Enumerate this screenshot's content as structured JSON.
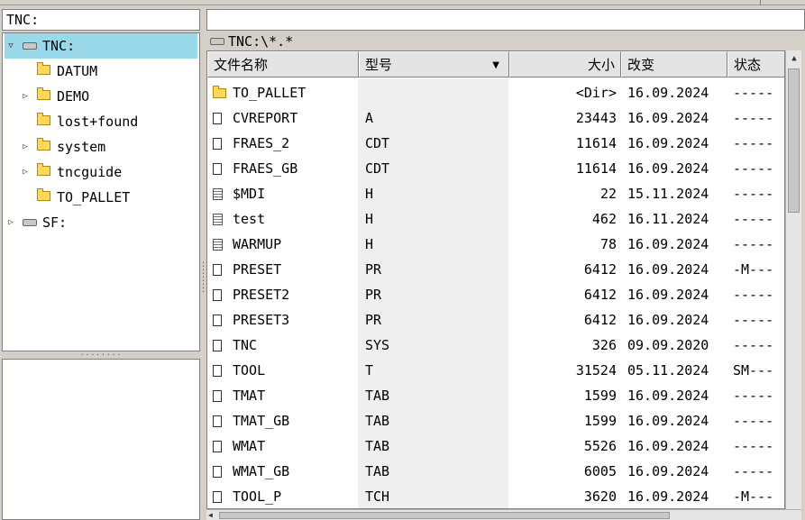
{
  "left_path": "TNC:",
  "right_path": "TNC:\\*.*",
  "tree": [
    {
      "label": "TNC:",
      "kind": "drive",
      "level": 0,
      "expander": "expanded",
      "selected": true
    },
    {
      "label": "DATUM",
      "kind": "folder",
      "level": 1,
      "expander": "none"
    },
    {
      "label": "DEMO",
      "kind": "folder",
      "level": 1,
      "expander": "collapsed"
    },
    {
      "label": "lost+found",
      "kind": "folder",
      "level": 1,
      "expander": "none"
    },
    {
      "label": "system",
      "kind": "folder",
      "level": 1,
      "expander": "collapsed"
    },
    {
      "label": "tncguide",
      "kind": "folder",
      "level": 1,
      "expander": "collapsed"
    },
    {
      "label": "TO_PALLET",
      "kind": "folder",
      "level": 1,
      "expander": "none"
    },
    {
      "label": "SF:",
      "kind": "drive",
      "level": 0,
      "expander": "collapsed"
    }
  ],
  "columns": {
    "name": "文件名称",
    "type": "型号",
    "size": "大小",
    "changed": "改变",
    "status": "状态"
  },
  "files": [
    {
      "icon": "folder",
      "name": "TO_PALLET",
      "type": "",
      "size": "<Dir>",
      "date": "16.09.2024",
      "status": "-----"
    },
    {
      "icon": "file",
      "name": "CVREPORT",
      "type": "A",
      "size": "23443",
      "date": "16.09.2024",
      "status": "-----"
    },
    {
      "icon": "file",
      "name": "FRAES_2",
      "type": "CDT",
      "size": "11614",
      "date": "16.09.2024",
      "status": "-----"
    },
    {
      "icon": "file",
      "name": "FRAES_GB",
      "type": "CDT",
      "size": "11614",
      "date": "16.09.2024",
      "status": "-----"
    },
    {
      "icon": "text",
      "name": "$MDI",
      "type": "H",
      "size": "22",
      "date": "15.11.2024",
      "status": "-----"
    },
    {
      "icon": "text",
      "name": "test",
      "type": "H",
      "size": "462",
      "date": "16.11.2024",
      "status": "-----"
    },
    {
      "icon": "text",
      "name": "WARMUP",
      "type": "H",
      "size": "78",
      "date": "16.09.2024",
      "status": "-----"
    },
    {
      "icon": "file",
      "name": "PRESET",
      "type": "PR",
      "size": "6412",
      "date": "16.09.2024",
      "status": "-M---"
    },
    {
      "icon": "file",
      "name": "PRESET2",
      "type": "PR",
      "size": "6412",
      "date": "16.09.2024",
      "status": "-----"
    },
    {
      "icon": "file",
      "name": "PRESET3",
      "type": "PR",
      "size": "6412",
      "date": "16.09.2024",
      "status": "-----"
    },
    {
      "icon": "file",
      "name": "TNC",
      "type": "SYS",
      "size": "326",
      "date": "09.09.2020",
      "status": "-----"
    },
    {
      "icon": "file",
      "name": "TOOL",
      "type": "T",
      "size": "31524",
      "date": "05.11.2024",
      "status": "SM---"
    },
    {
      "icon": "file",
      "name": "TMAT",
      "type": "TAB",
      "size": "1599",
      "date": "16.09.2024",
      "status": "-----"
    },
    {
      "icon": "file",
      "name": "TMAT_GB",
      "type": "TAB",
      "size": "1599",
      "date": "16.09.2024",
      "status": "-----"
    },
    {
      "icon": "file",
      "name": "WMAT",
      "type": "TAB",
      "size": "5526",
      "date": "16.09.2024",
      "status": "-----"
    },
    {
      "icon": "file",
      "name": "WMAT_GB",
      "type": "TAB",
      "size": "6005",
      "date": "16.09.2024",
      "status": "-----"
    },
    {
      "icon": "file",
      "name": "TOOL_P",
      "type": "TCH",
      "size": "3620",
      "date": "16.09.2024",
      "status": "-M---"
    }
  ]
}
